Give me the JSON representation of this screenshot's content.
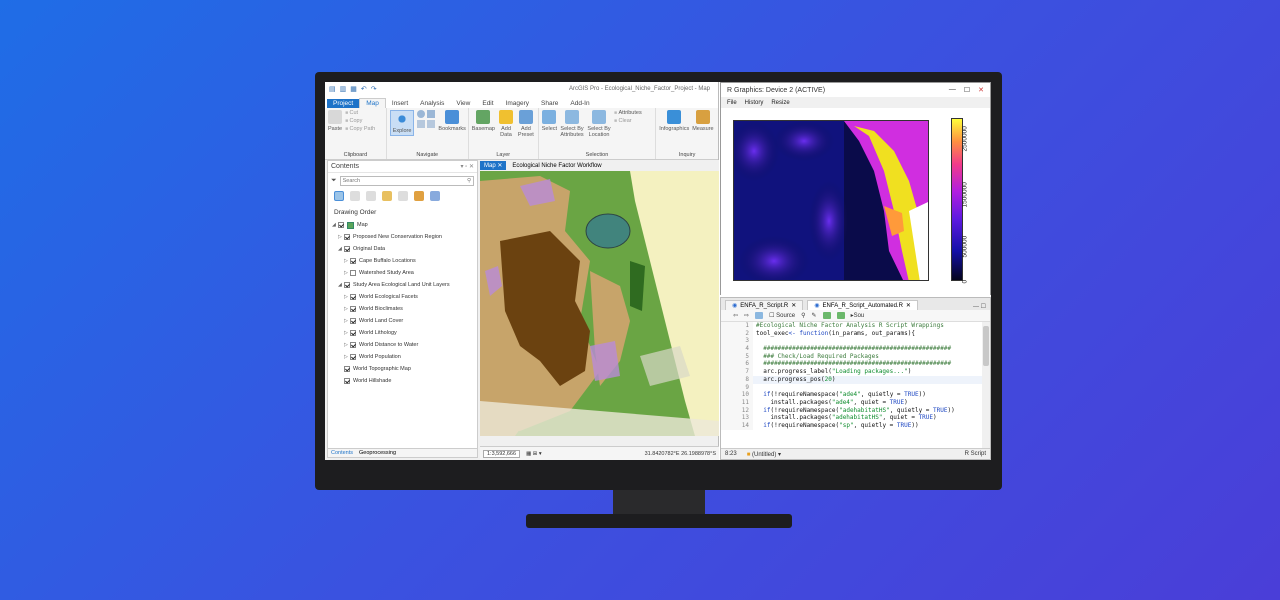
{
  "arcgis": {
    "window_title": "ArcGIS Pro - Ecological_Niche_Factor_Project - Map",
    "tabs": [
      "Project",
      "Map",
      "Insert",
      "Analysis",
      "View",
      "Edit",
      "Imagery",
      "Share",
      "Add-In"
    ],
    "ribbon": {
      "clipboard": {
        "paste": "Paste",
        "cut": "Cut",
        "copy": "Copy",
        "copy_path": "Copy Path",
        "group": "Clipboard"
      },
      "navigate": {
        "explore": "Explore",
        "bookmarks": "Bookmarks",
        "group": "Navigate"
      },
      "layer": {
        "basemap": "Basemap",
        "add_data": "Add Data",
        "add_preset": "Add Preset",
        "group": "Layer"
      },
      "selection": {
        "select": "Select",
        "select_by_attributes": "Select By Attributes",
        "select_by_location": "Select By Location",
        "attributes": "Attributes",
        "clear": "Clear",
        "group": "Selection"
      },
      "inquiry": {
        "infographics": "Infographics",
        "measure": "Measure",
        "group": "Inquiry"
      }
    },
    "contents": {
      "title": "Contents",
      "search_placeholder": "Search",
      "drawing_order": "Drawing Order",
      "layers": [
        {
          "name": "Map",
          "level": 0,
          "checked": true,
          "arrow": "◢"
        },
        {
          "name": "Proposed New Conservation Region",
          "level": 1,
          "checked": true,
          "arrow": "▷"
        },
        {
          "name": "Original Data",
          "level": 1,
          "checked": true,
          "arrow": "◢"
        },
        {
          "name": "Cape Buffalo Locations",
          "level": 2,
          "checked": true,
          "arrow": "▷"
        },
        {
          "name": "Watershed Study Area",
          "level": 2,
          "checked": false,
          "arrow": "▷"
        },
        {
          "name": "Study Area Ecological Land Unit Layers",
          "level": 1,
          "checked": true,
          "arrow": "◢"
        },
        {
          "name": "World Ecological Facets",
          "level": 2,
          "checked": true,
          "arrow": "▷"
        },
        {
          "name": "World Bioclimates",
          "level": 2,
          "checked": true,
          "arrow": "▷"
        },
        {
          "name": "World Land Cover",
          "level": 2,
          "checked": true,
          "arrow": "▷"
        },
        {
          "name": "World Lithology",
          "level": 2,
          "checked": true,
          "arrow": "▷"
        },
        {
          "name": "World Distance to Water",
          "level": 2,
          "checked": true,
          "arrow": "▷"
        },
        {
          "name": "World Population",
          "level": 2,
          "checked": true,
          "arrow": "▷"
        },
        {
          "name": "World Topographic Map",
          "level": 1,
          "checked": true,
          "arrow": ""
        },
        {
          "name": "World Hillshade",
          "level": 1,
          "checked": true,
          "arrow": ""
        }
      ],
      "bottom_tabs": [
        "Contents",
        "Geoprocessing"
      ]
    },
    "map_tabs": [
      "Map",
      "Ecological Niche Factor Workflow"
    ],
    "scale": "1:3,592,666",
    "coords": "31.8420782°E 26.1988978°S"
  },
  "rgraphics": {
    "title": "R Graphics: Device 2 (ACTIVE)",
    "menu": [
      "File",
      "History",
      "Resize"
    ],
    "colorbar_ticks": [
      "0",
      "500000",
      "1500000",
      "2500000"
    ]
  },
  "rstudio": {
    "tabs": [
      "ENFA_R_Script.R",
      "ENFA_R_Script_Automated.R"
    ],
    "source_label": "Source",
    "status_pos": "8:23",
    "status_scope": "(Untitled)",
    "status_lang": "R Script",
    "code": [
      {
        "n": "1",
        "html": "<span class='c-comment'>#Ecological Niche Factor Analysis R Script Wrappings</span>"
      },
      {
        "n": "2",
        "html": "tool_exec<span class='c-kw'>&lt;-</span> <span class='c-kw'>function</span>(in_params, out_params){"
      },
      {
        "n": "3",
        "html": ""
      },
      {
        "n": "4",
        "html": "  <span class='c-comment'>####################################################</span>"
      },
      {
        "n": "5",
        "html": "  <span class='c-comment'>### Check/Load Required Packages</span>"
      },
      {
        "n": "6",
        "html": "  <span class='c-comment'>####################################################</span>"
      },
      {
        "n": "7",
        "html": "  arc.progress_label(<span class='c-str'>\"Loading packages...\"</span>)"
      },
      {
        "n": "8",
        "html": "  arc.progress_pos(<span class='c-num'>20</span>)",
        "hl": true
      },
      {
        "n": "9",
        "html": ""
      },
      {
        "n": "10",
        "html": "  <span class='c-kw'>if</span>(!requireNamespace(<span class='c-str'>\"ade4\"</span>, quietly = <span class='c-kw'>TRUE</span>))"
      },
      {
        "n": "11",
        "html": "    install.packages(<span class='c-str'>\"ade4\"</span>, quiet = <span class='c-kw'>TRUE</span>)"
      },
      {
        "n": "12",
        "html": "  <span class='c-kw'>if</span>(!requireNamespace(<span class='c-str'>\"adehabitatHS\"</span>, quietly = <span class='c-kw'>TRUE</span>))"
      },
      {
        "n": "13",
        "html": "    install.packages(<span class='c-str'>\"adehabitatHS\"</span>, quiet = <span class='c-kw'>TRUE</span>)"
      },
      {
        "n": "14",
        "html": "  <span class='c-kw'>if</span>(!requireNamespace(<span class='c-str'>\"sp\"</span>, quietly = <span class='c-kw'>TRUE</span>))"
      }
    ]
  }
}
